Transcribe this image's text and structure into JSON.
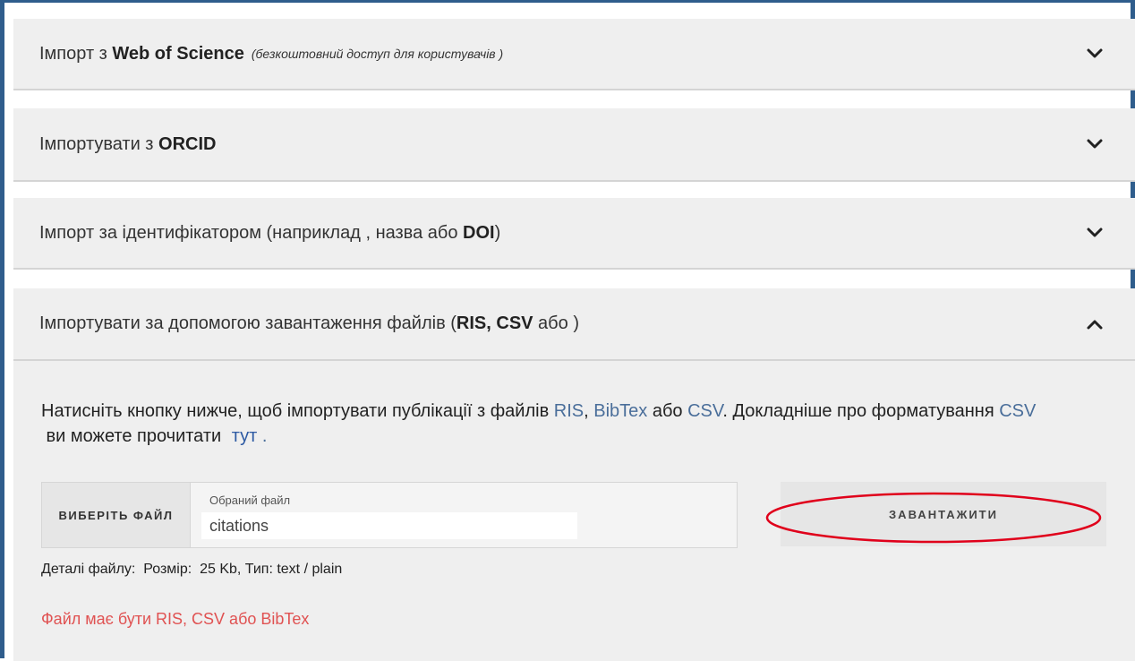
{
  "panels": [
    {
      "title_prefix": "Імпорт з ",
      "title_bold": "Web of Science",
      "title_italic": "(безкоштовний доступ для користувачів )",
      "expanded": false
    },
    {
      "title_prefix": "Імпортувати з ",
      "title_bold": "ORCID",
      "expanded": false
    },
    {
      "title_prefix": "Імпорт за ідентифікатором (наприклад , назва або ",
      "title_bold": "DOI",
      "title_suffix": ")",
      "expanded": false
    },
    {
      "title_prefix": "Імпортувати за допомогою завантаження файлів (",
      "title_bold": "RIS, CSV",
      "title_suffix": " або )",
      "expanded": true
    }
  ],
  "upload": {
    "desc_part1": "Натисніть кнопку нижче, щоб імпортувати публікації з файлів ",
    "ris": "RIS",
    "sep1": ", ",
    "bibtex": "BibTex",
    "or": " або ",
    "csv": "CSV",
    "desc_part2": ". Докладніше про форматування ",
    "csv2": "CSV",
    "desc_part3": " ви можете прочитати ",
    "here_link": "тут",
    "dot": " .",
    "choose_file_label": "ВИБЕРІТЬ ФАЙЛ",
    "selected_file_label": "Обраний файл",
    "selected_file_value": "citations",
    "upload_button_label": "ЗАВАНТАЖИТИ",
    "file_details": "Деталі файлу:  Розмір:  25 Kb, Тип: text / plain",
    "error_message": "Файл має бути RIS, CSV або BibTex"
  },
  "colors": {
    "frame_border": "#2f5d8c",
    "annotation_ellipse": "#e0001b",
    "error_text": "#e05252",
    "link_text": "#4a6e9a"
  },
  "icons": {
    "collapsed": "chevron-down-icon",
    "expanded": "chevron-up-icon"
  }
}
